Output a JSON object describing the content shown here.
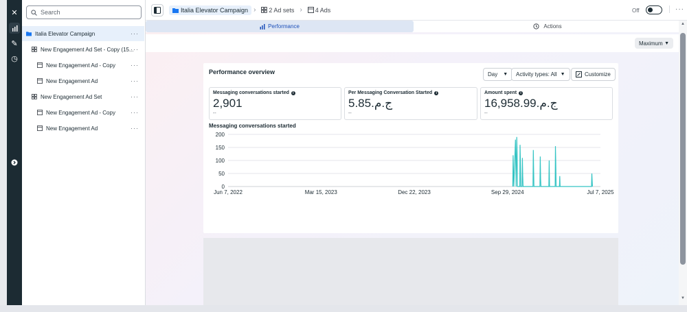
{
  "search": {
    "placeholder": "Search"
  },
  "tree": [
    {
      "label": "Italia Elevator Campaign",
      "level": 0,
      "type": "campaign",
      "selected": true
    },
    {
      "label": "New Engagement Ad Set - Copy (15...",
      "level": 1,
      "type": "adset"
    },
    {
      "label": "New Engagement Ad - Copy",
      "level": 2,
      "type": "ad"
    },
    {
      "label": "New Engagement Ad",
      "level": 2,
      "type": "ad"
    },
    {
      "label": "New Engagement Ad Set",
      "level": 1,
      "type": "adset"
    },
    {
      "label": "New Engagement Ad - Copy",
      "level": 2,
      "type": "ad"
    },
    {
      "label": "New Engagement Ad",
      "level": 2,
      "type": "ad"
    }
  ],
  "breadcrumb": {
    "campaign": "Italia Elevator Campaign",
    "adsets": "2 Ad sets",
    "ads": "4 Ads"
  },
  "status": {
    "toggle_label": "Off"
  },
  "tabs": {
    "performance": "Performance",
    "actions": "Actions"
  },
  "maximum": "Maximum",
  "overview": {
    "title": "Performance overview",
    "day": "Day",
    "activity": "Activity types: All",
    "customize": "Customize"
  },
  "metrics": [
    {
      "label": "Messaging conversations started",
      "value": "2,901",
      "sub": "--"
    },
    {
      "label": "Per Messaging Conversation Started",
      "value": "5.85‏ج.م.‏",
      "sub": "--"
    },
    {
      "label": "Amount spent",
      "value": "16,958.99‏ج.م.‏",
      "sub": "--"
    }
  ],
  "chart_data": {
    "type": "line",
    "title": "Messaging conversations started",
    "ylim": [
      0,
      200
    ],
    "yticks": [
      0,
      50,
      100,
      150,
      200
    ],
    "xtick_labels": [
      "Jun 7, 2022",
      "Mar 15, 2023",
      "Dec 22, 2023",
      "Sep 29, 2024",
      "Jul 7, 2025"
    ],
    "grid": true,
    "color": "#35c4c4",
    "series": [
      {
        "points": [
          [
            "2024-10-15",
            0
          ],
          [
            "2024-10-16",
            120
          ],
          [
            "2024-10-17",
            60
          ],
          [
            "2024-10-18",
            0
          ],
          [
            "2024-10-22",
            140
          ],
          [
            "2024-10-23",
            180
          ],
          [
            "2024-10-24",
            90
          ],
          [
            "2024-10-25",
            0
          ],
          [
            "2024-10-27",
            190
          ],
          [
            "2024-10-28",
            130
          ],
          [
            "2024-10-29",
            0
          ],
          [
            "2024-11-05",
            0
          ],
          [
            "2024-11-06",
            160
          ],
          [
            "2024-11-07",
            100
          ],
          [
            "2024-11-08",
            0
          ],
          [
            "2024-11-12",
            0
          ],
          [
            "2024-11-13",
            110
          ],
          [
            "2024-11-14",
            40
          ],
          [
            "2024-11-15",
            0
          ],
          [
            "2024-12-15",
            0
          ],
          [
            "2024-12-16",
            140
          ],
          [
            "2024-12-17",
            60
          ],
          [
            "2024-12-18",
            0
          ],
          [
            "2025-01-05",
            0
          ],
          [
            "2025-01-06",
            115
          ],
          [
            "2025-01-07",
            30
          ],
          [
            "2025-01-08",
            0
          ],
          [
            "2025-02-01",
            0
          ],
          [
            "2025-02-02",
            100
          ],
          [
            "2025-02-03",
            0
          ],
          [
            "2025-02-20",
            0
          ],
          [
            "2025-02-21",
            155
          ],
          [
            "2025-02-22",
            90
          ],
          [
            "2025-02-23",
            0
          ],
          [
            "2025-03-05",
            0
          ],
          [
            "2025-03-06",
            40
          ],
          [
            "2025-03-07",
            0
          ],
          [
            "2025-06-10",
            0
          ],
          [
            "2025-06-11",
            50
          ],
          [
            "2025-06-12",
            20
          ],
          [
            "2025-06-13",
            0
          ]
        ]
      }
    ]
  }
}
